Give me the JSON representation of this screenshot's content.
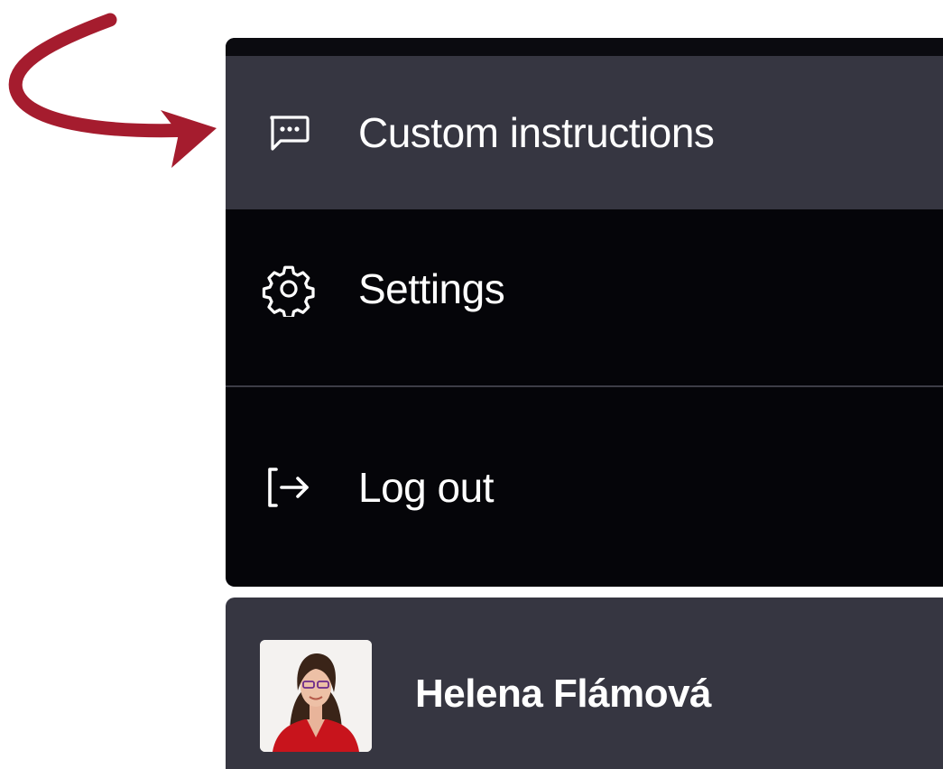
{
  "colors": {
    "annotation_arrow": "#a51c2e",
    "menu_background": "#050509",
    "menu_active": "#363641",
    "text": "#ffffff"
  },
  "menu": {
    "items": [
      {
        "label": "Custom instructions",
        "icon": "chat-bubble-icon",
        "active": true
      },
      {
        "label": "Settings",
        "icon": "gear-icon",
        "active": false
      },
      {
        "label": "Log out",
        "icon": "logout-icon",
        "active": false
      }
    ]
  },
  "user": {
    "name": "Helena Flámová",
    "avatar": "avatar"
  }
}
